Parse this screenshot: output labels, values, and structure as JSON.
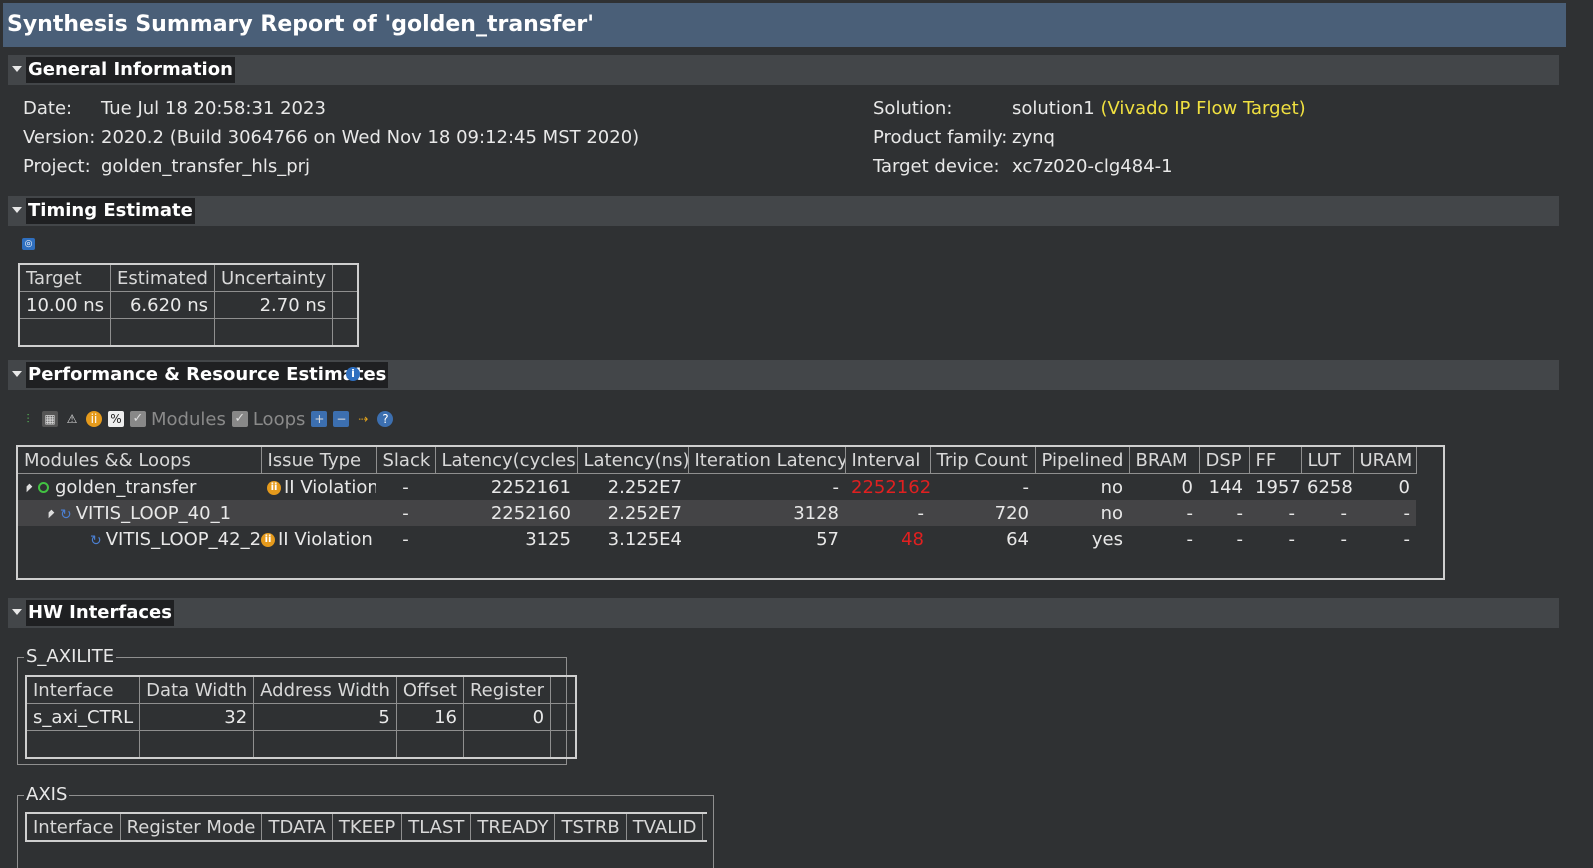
{
  "report_title": "Synthesis Summary Report of 'golden_transfer'",
  "sections": {
    "general": "General Information",
    "timing": "Timing Estimate",
    "perf": "Performance & Resource Estimates",
    "hw": "HW Interfaces"
  },
  "general": {
    "date_label": "Date:",
    "date": "Tue Jul 18 20:58:31 2023",
    "version_label": "Version:",
    "version": "2020.2 (Build 3064766 on Wed Nov 18 09:12:45 MST 2020)",
    "project_label": "Project:",
    "project": "golden_transfer_hls_prj",
    "solution_label": "Solution:",
    "solution": "solution1",
    "solution_flow": "(Vivado IP Flow Target)",
    "family_label": "Product family:",
    "family": "zynq",
    "device_label": "Target device:",
    "device": "xc7z020-clg484-1"
  },
  "timing": {
    "headers": [
      "Target",
      "Estimated",
      "Uncertainty"
    ],
    "row": [
      "10.00 ns",
      "6.620 ns",
      "2.70 ns"
    ]
  },
  "perf_toolbar": {
    "modules": "Modules",
    "loops": "Loops"
  },
  "perf": {
    "headers": [
      "Modules && Loops",
      "Issue Type",
      "Slack",
      "Latency(cycles)",
      "Latency(ns)",
      "Iteration Latency",
      "Interval",
      "Trip Count",
      "Pipelined",
      "BRAM",
      "DSP",
      "FF",
      "LUT",
      "URAM"
    ],
    "rows": [
      {
        "name": "golden_transfer",
        "issue": "II Violation",
        "slack": "-",
        "lat_cycles": "2252161",
        "lat_ns": "2.252E7",
        "iter_lat": "-",
        "interval": "2252162",
        "trip": "-",
        "pipelined": "no",
        "bram": "0",
        "dsp": "144",
        "ff": "1957",
        "lut": "6258",
        "uram": "0"
      },
      {
        "name": "VITIS_LOOP_40_1",
        "issue": "",
        "slack": "-",
        "lat_cycles": "2252160",
        "lat_ns": "2.252E7",
        "iter_lat": "3128",
        "interval": "-",
        "trip": "720",
        "pipelined": "no",
        "bram": "-",
        "dsp": "-",
        "ff": "-",
        "lut": "-",
        "uram": "-"
      },
      {
        "name": "VITIS_LOOP_42_2",
        "issue": "II Violation",
        "slack": "-",
        "lat_cycles": "3125",
        "lat_ns": "3.125E4",
        "iter_lat": "57",
        "interval": "48",
        "trip": "64",
        "pipelined": "yes",
        "bram": "-",
        "dsp": "-",
        "ff": "-",
        "lut": "-",
        "uram": "-"
      }
    ]
  },
  "saxilite": {
    "legend": "S_AXILITE",
    "headers": [
      "Interface",
      "Data Width",
      "Address Width",
      "Offset",
      "Register"
    ],
    "row": [
      "s_axi_CTRL",
      "32",
      "5",
      "16",
      "0"
    ]
  },
  "axis": {
    "legend": "AXIS",
    "headers": [
      "Interface",
      "Register Mode",
      "TDATA",
      "TKEEP",
      "TLAST",
      "TREADY",
      "TSTRB",
      "TVALID"
    ]
  }
}
